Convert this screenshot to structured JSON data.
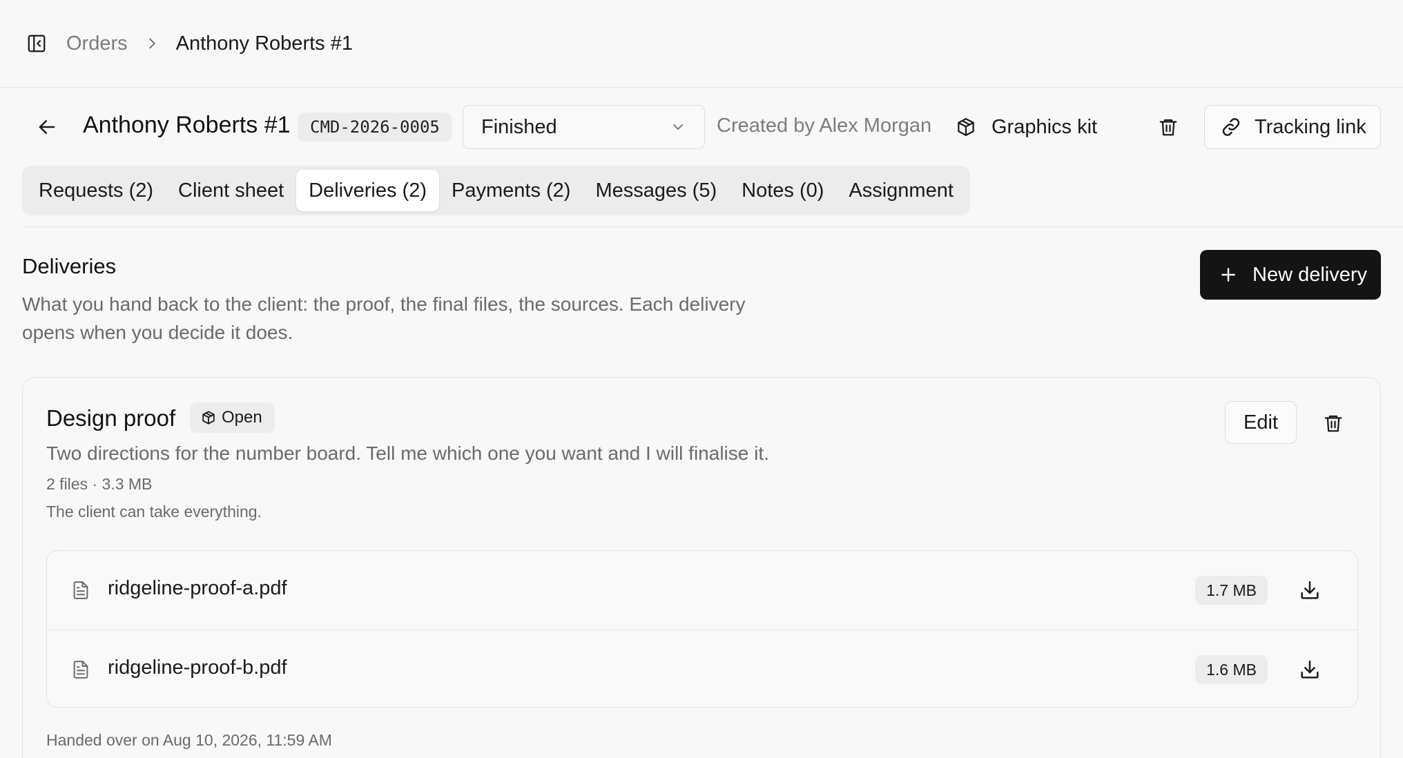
{
  "breadcrumb": {
    "parent": "Orders",
    "current": "Anthony Roberts #1"
  },
  "header": {
    "title": "Anthony Roberts #1",
    "order_code": "CMD-2026-0005",
    "status": "Finished",
    "created_by": "Created by Alex Morgan",
    "graphics_kit_label": "Graphics kit",
    "tracking_link_label": "Tracking link"
  },
  "tabs": [
    {
      "label": "Requests (2)",
      "active": false
    },
    {
      "label": "Client sheet",
      "active": false
    },
    {
      "label": "Deliveries (2)",
      "active": true
    },
    {
      "label": "Payments (2)",
      "active": false
    },
    {
      "label": "Messages (5)",
      "active": false
    },
    {
      "label": "Notes (0)",
      "active": false
    },
    {
      "label": "Assignment",
      "active": false
    }
  ],
  "section": {
    "title": "Deliveries",
    "description": "What you hand back to the client: the proof, the final files, the sources. Each delivery opens when you decide it does.",
    "new_button_label": "New delivery"
  },
  "delivery": {
    "title": "Design proof",
    "badge": "Open",
    "description": "Two directions for the number board. Tell me which one you want and I will finalise it.",
    "meta": "2 files · 3.3 MB",
    "access": "The client can take everything.",
    "edit_label": "Edit",
    "files": [
      {
        "name": "ridgeline-proof-a.pdf",
        "size": "1.7 MB"
      },
      {
        "name": "ridgeline-proof-b.pdf",
        "size": "1.6 MB"
      }
    ],
    "handed_over": "Handed over on Aug 10, 2026, 11:59 AM"
  },
  "icons": {
    "sidebar_toggle": "sidebar-toggle-icon",
    "breadcrumb_separator": "chevron-right-icon",
    "back": "arrow-left-icon",
    "status_dropdown": "chevron-down-icon",
    "graphics_kit": "package-icon",
    "delete": "trash-icon",
    "tracking": "link-icon",
    "new": "plus-icon",
    "file": "file-text-icon",
    "download": "download-icon"
  },
  "colors": {
    "background": "#f8f8f8",
    "primary_button": "#141414",
    "muted_text": "#6a6a6a",
    "chip_background": "#ececec"
  }
}
